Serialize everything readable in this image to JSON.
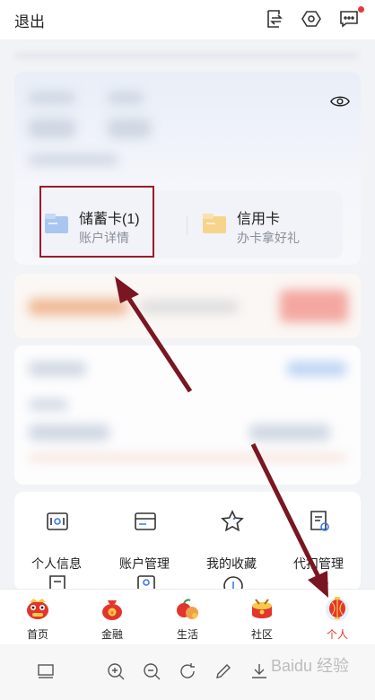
{
  "header": {
    "back_label": "退出",
    "icons": [
      "transfer-icon",
      "settings-icon",
      "message-icon"
    ]
  },
  "cards": {
    "debit": {
      "title": "储蓄卡(1)",
      "subtitle": "账户详情",
      "icon": "debit-card-icon"
    },
    "credit": {
      "title": "信用卡",
      "subtitle": "办卡拿好礼",
      "icon": "credit-card-icon"
    }
  },
  "menu": {
    "items": [
      {
        "label": "个人信息",
        "icon": "personal-info-icon"
      },
      {
        "label": "账户管理",
        "icon": "account-management-icon"
      },
      {
        "label": "我的收藏",
        "icon": "favorites-icon"
      },
      {
        "label": "代扣管理",
        "icon": "auto-debit-icon"
      }
    ]
  },
  "tabbar": {
    "tabs": [
      {
        "label": "首页",
        "icon": "home-lion-icon"
      },
      {
        "label": "金融",
        "icon": "finance-moneybag-icon"
      },
      {
        "label": "生活",
        "icon": "life-fruit-icon"
      },
      {
        "label": "社区",
        "icon": "community-drum-icon"
      },
      {
        "label": "个人",
        "icon": "personal-lantern-icon"
      }
    ],
    "active_index": 4
  },
  "toolbar": {
    "icons": [
      "layout-icon",
      "zoom-in-icon",
      "zoom-out-icon",
      "rotate-icon",
      "edit-icon",
      "download-icon"
    ]
  },
  "watermark": "Baidu 经验",
  "colors": {
    "accent_red": "#e0342a",
    "highlight": "#9b1c2a"
  }
}
